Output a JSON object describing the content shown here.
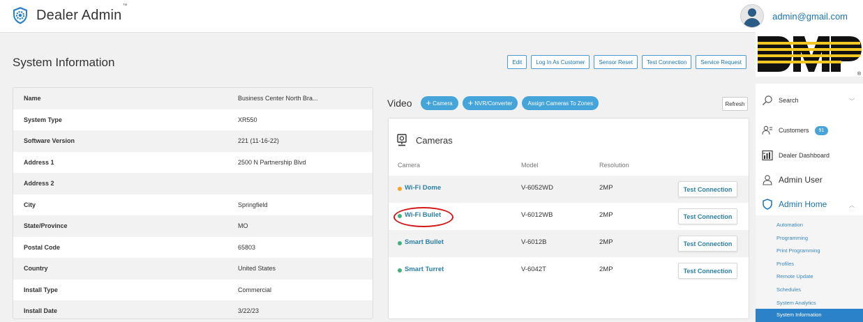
{
  "app": {
    "name": "Dealer Admin",
    "tm": "™"
  },
  "user": {
    "email": "admin@gmail.com"
  },
  "page": {
    "title": "System Information"
  },
  "actions": {
    "edit": "Edit",
    "log_in_as_customer": "Log In As Customer",
    "sensor_reset": "Sensor Reset",
    "test_connection": "Test Connection",
    "service_request": "Service Request"
  },
  "logo": {
    "text": "DMP",
    "mark": "®"
  },
  "system_info": [
    {
      "label": "Name",
      "value": "Business Center North Bra..."
    },
    {
      "label": "System Type",
      "value": "XR550"
    },
    {
      "label": "Software Version",
      "value": "221 (11-16-22)"
    },
    {
      "label": "Address 1",
      "value": "2500 N Partnership Blvd"
    },
    {
      "label": "Address 2",
      "value": ""
    },
    {
      "label": "City",
      "value": "Springfield"
    },
    {
      "label": "State/Province",
      "value": "MO"
    },
    {
      "label": "Postal Code",
      "value": "65803"
    },
    {
      "label": "Country",
      "value": "United States"
    },
    {
      "label": "Install Type",
      "value": "Commercial"
    },
    {
      "label": "Install Date",
      "value": "3/22/23"
    }
  ],
  "video": {
    "label": "Video",
    "add_camera": "Camera",
    "add_nvr": "NVR/Converter",
    "assign": "Assign Cameras To Zones",
    "refresh": "Refresh"
  },
  "cameras": {
    "title": "Cameras",
    "columns": {
      "camera": "Camera",
      "model": "Model",
      "resolution": "Resolution"
    },
    "rows": [
      {
        "name": "Wi-Fi Dome",
        "model": "V-6052WD",
        "resolution": "2MP",
        "status_color": "#f5a623",
        "action": "Test Connection"
      },
      {
        "name": "Wi-Fi Bullet",
        "model": "V-6012WB",
        "resolution": "2MP",
        "status_color": "#3fb27f",
        "action": "Test Connection"
      },
      {
        "name": "Smart Bullet",
        "model": "V-6012B",
        "resolution": "2MP",
        "status_color": "#3fb27f",
        "action": "Test Connection"
      },
      {
        "name": "Smart Turret",
        "model": "V-6042T",
        "resolution": "2MP",
        "status_color": "#3fb27f",
        "action": "Test Connection"
      }
    ]
  },
  "sidebar": {
    "search": "Search",
    "customers": "Customers",
    "customers_count": "91",
    "dealer_dashboard": "Dealer Dashboard",
    "admin_user": "Admin User",
    "admin_home": "Admin Home",
    "sub_items": [
      "Automation",
      "Programming",
      "Print Programming",
      "Profiles",
      "Remote Update",
      "Schedules",
      "System Analytics",
      "System Information"
    ]
  },
  "colors": {
    "accent": "#45a5da",
    "link": "#1a73b5",
    "highlight_ring": "#d4161a",
    "active_nav": "#2b82c8"
  }
}
